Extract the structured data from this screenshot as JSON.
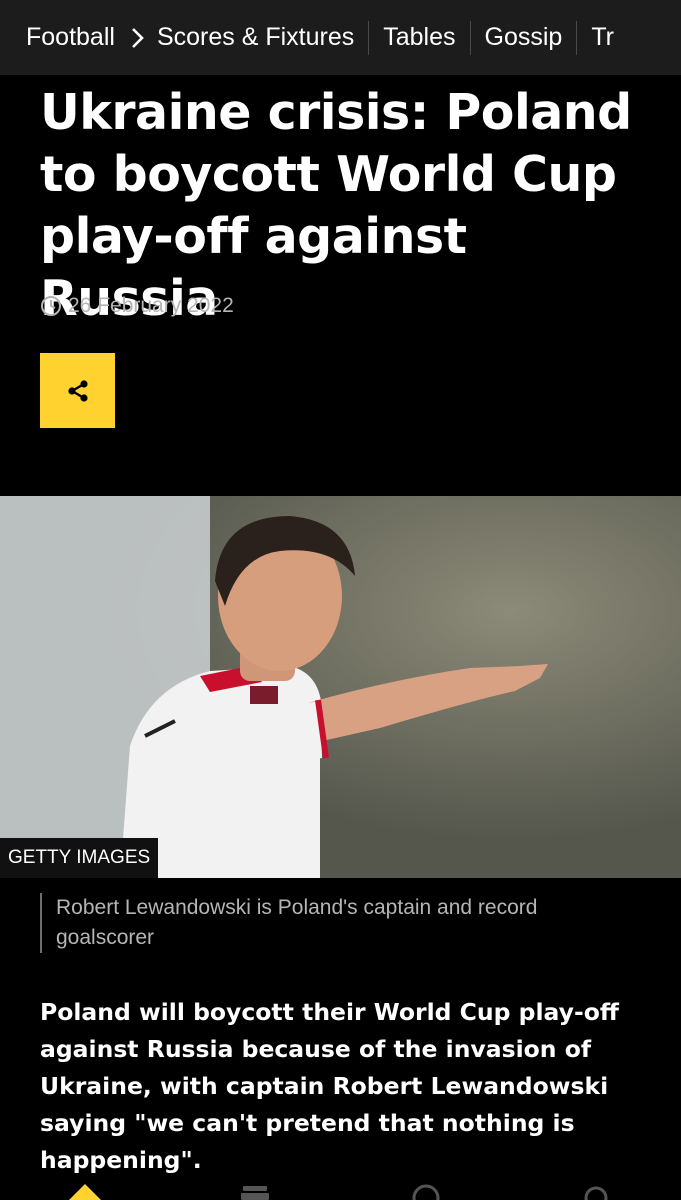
{
  "nav": {
    "section": "Football",
    "items": [
      "Scores & Fixtures",
      "Tables",
      "Gossip",
      "Tr"
    ]
  },
  "article": {
    "headline": "Ukraine crisis: Poland to boycott World Cup play-off against Russia",
    "date": "26 February 2022",
    "image_credit": "GETTY IMAGES",
    "caption": "Robert Lewandowski is Poland's captain and record goalscorer",
    "lede": "Poland will boycott their World Cup play-off against Russia because of the invasion of Ukraine, with captain Robert Lewandowski saying \"we can't pretend that nothing is happening\"."
  },
  "colors": {
    "accent": "#ffd230",
    "background": "#000000",
    "nav_background": "#1c1c1c"
  },
  "icons": {
    "nav_chevron": "chevron-right-icon",
    "date": "clock-icon",
    "share": "share-icon",
    "tabs": [
      "home-icon",
      "my-news-icon",
      "sport-icon",
      "search-icon"
    ]
  }
}
